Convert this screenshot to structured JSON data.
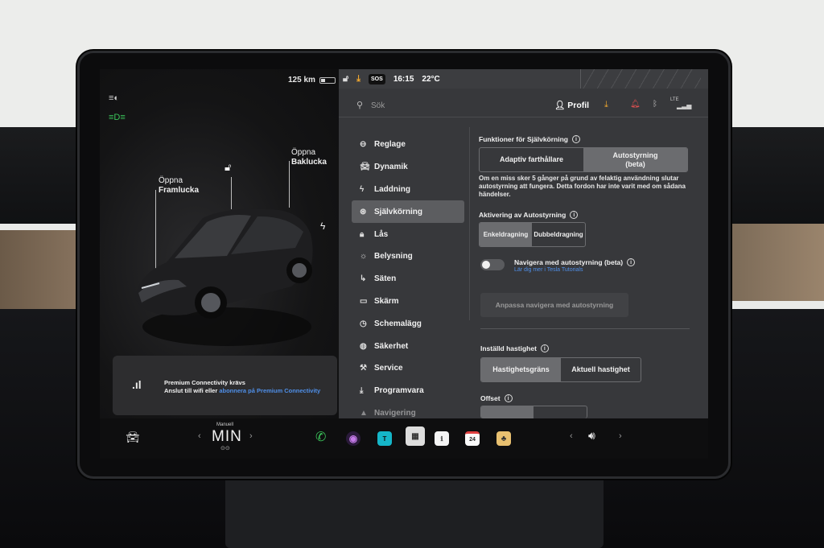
{
  "status": {
    "range": "125 km",
    "time": "16:15",
    "temp": "22°C",
    "sos": "SOS"
  },
  "car": {
    "front_trunk_label_1": "Öppna",
    "front_trunk_label_2": "Framlucka",
    "rear_trunk_label_1": "Öppna",
    "rear_trunk_label_2": "Baklucka"
  },
  "connectivity": {
    "line1": "Premium Connectivity krävs",
    "line2_prefix": "Anslut till wifi eller ",
    "line2_link": "abonnera på Premium Connectivity"
  },
  "header": {
    "search_placeholder": "Sök",
    "profile_label": "Profil",
    "lte": "LTE"
  },
  "nav": [
    {
      "label": "Reglage",
      "icon": "toggle-icon"
    },
    {
      "label": "Dynamik",
      "icon": "car-icon"
    },
    {
      "label": "Laddning",
      "icon": "bolt-icon"
    },
    {
      "label": "Självkörning",
      "icon": "steering-wheel-icon",
      "active": true
    },
    {
      "label": "Lås",
      "icon": "lock-icon"
    },
    {
      "label": "Belysning",
      "icon": "sun-icon"
    },
    {
      "label": "Säten",
      "icon": "seat-icon"
    },
    {
      "label": "Skärm",
      "icon": "screen-icon"
    },
    {
      "label": "Schemalägg",
      "icon": "clock-icon"
    },
    {
      "label": "Säkerhet",
      "icon": "shield-icon"
    },
    {
      "label": "Service",
      "icon": "wrench-icon"
    },
    {
      "label": "Programvara",
      "icon": "download-icon"
    },
    {
      "label": "Navigering",
      "icon": "navigation-icon"
    }
  ],
  "autopilot": {
    "features_title": "Funktioner för Självkörning",
    "opt_adaptive": "Adaptiv farthållare",
    "opt_autosteer_1": "Autostyrning",
    "opt_autosteer_2": "(beta)",
    "strike_text": "Om en miss sker 5 gånger på grund av felaktig användning slutar autostyrning att fungera. Detta fordon har inte varit med om sådana händelser.",
    "activation_title": "Aktivering av Autostyrning",
    "opt_single": "Enkeldragning",
    "opt_double": "Dubbeldragning",
    "nav_toggle_label": "Navigera med autostyrning (beta)",
    "nav_toggle_link": "Lär dig mer i Tesla Tutorials",
    "customize_button": "Anpassa navigera med autostyrning",
    "speed_title": "Inställd hastighet",
    "opt_speed_limit": "Hastighetsgräns",
    "opt_current_speed": "Aktuell hastighet",
    "offset_title": "Offset"
  },
  "taskbar": {
    "drive_mode_small": "Manuell",
    "drive_mode": "MIN",
    "calendar_day": "24"
  },
  "colors": {
    "accent_blue": "#4f8fe8",
    "download_orange": "#f0a830",
    "phone_green": "#3bc45a"
  }
}
